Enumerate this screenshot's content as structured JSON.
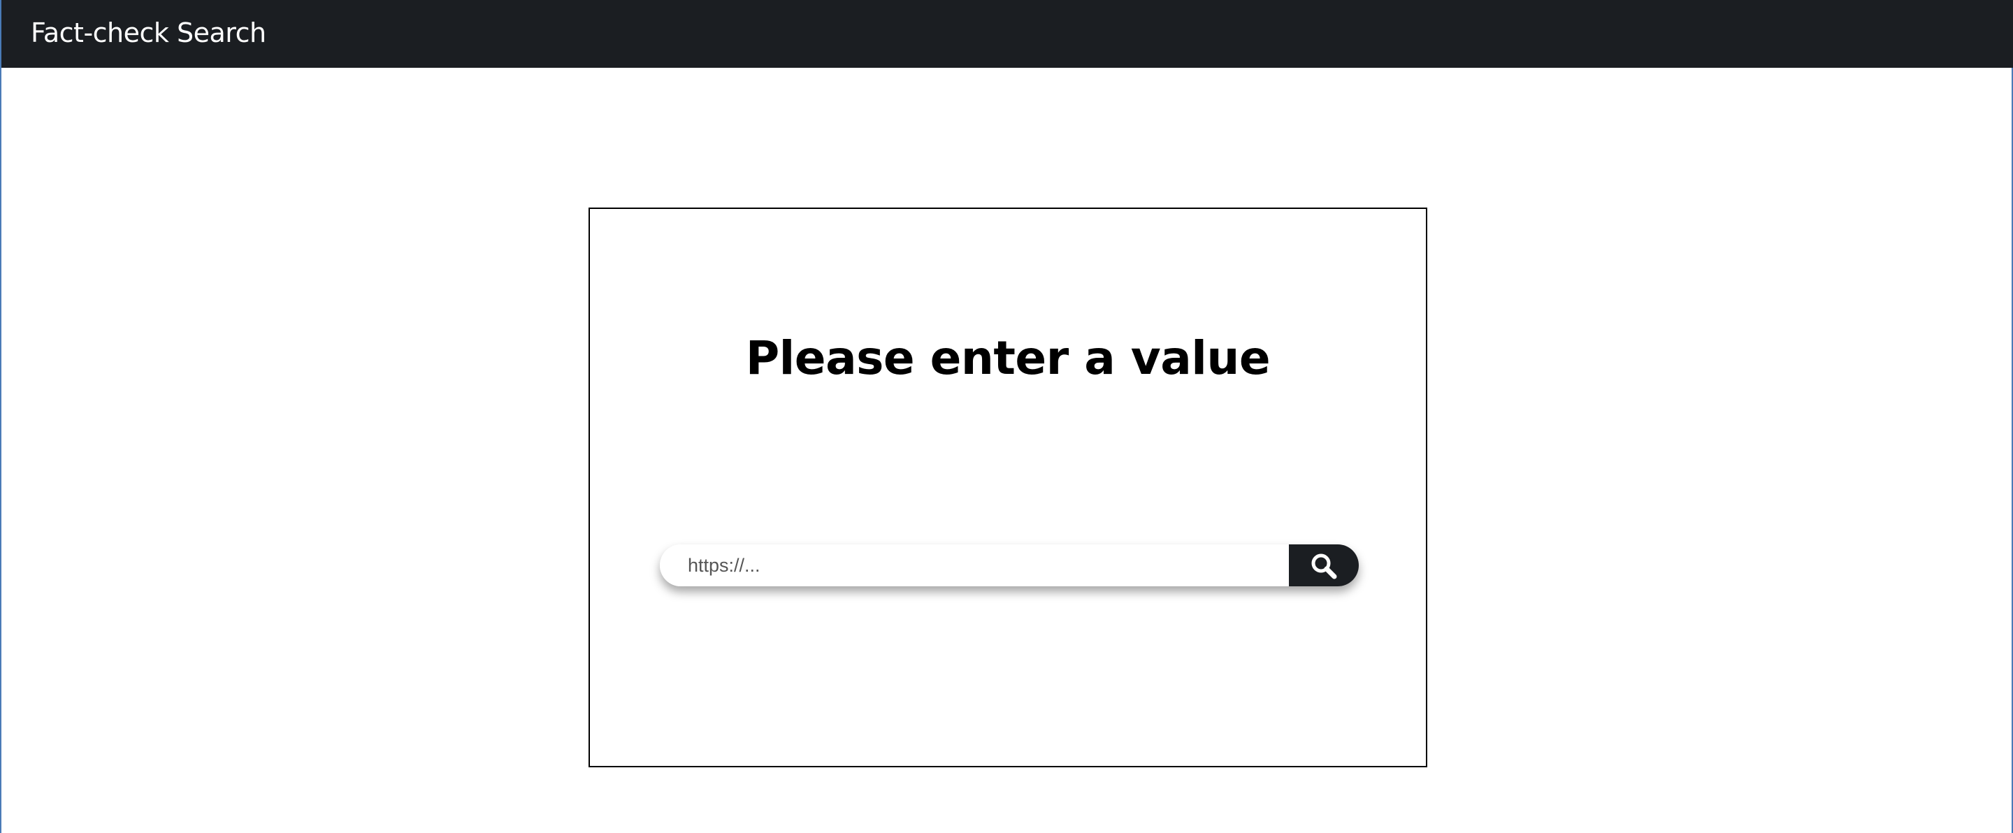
{
  "navbar": {
    "brand": "Fact-check Search"
  },
  "main": {
    "headline": "Please enter a value",
    "search": {
      "value": "",
      "placeholder": "https://...",
      "button_icon": "search-icon"
    }
  },
  "colors": {
    "navbar_bg": "#1b1e22",
    "text_primary": "#000000",
    "brand_text": "#ffffff"
  }
}
